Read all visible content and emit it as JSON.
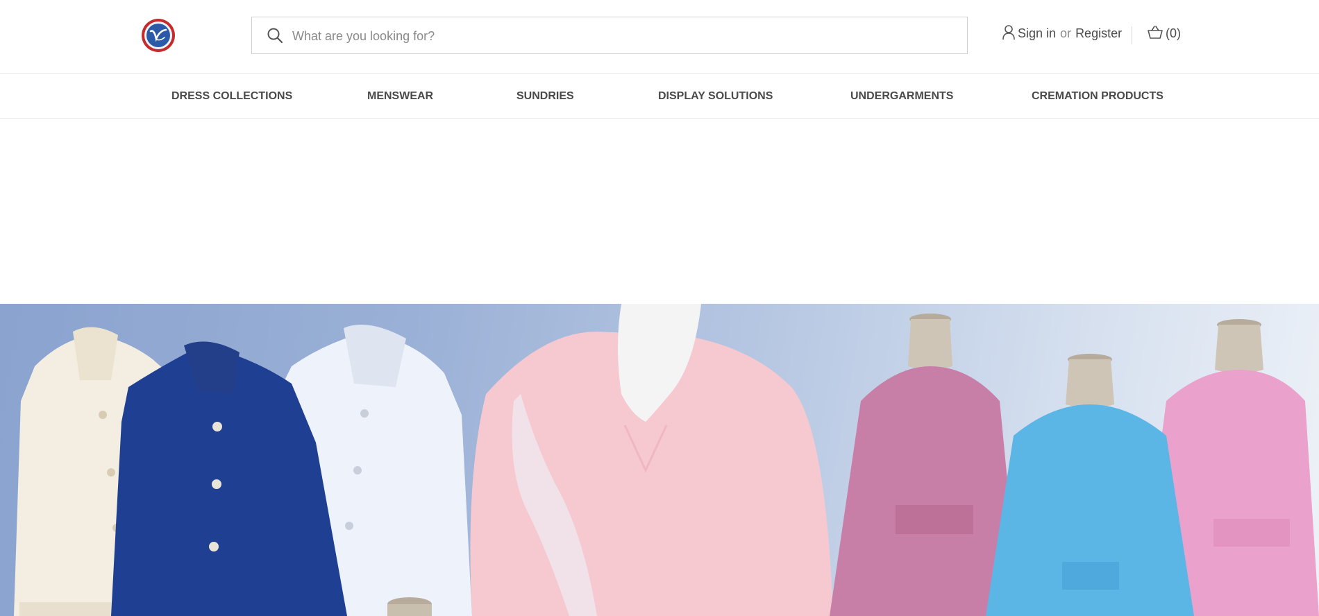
{
  "header": {
    "logo_alt": "Vega logo",
    "search": {
      "placeholder": "What are you looking for?",
      "value": ""
    },
    "account": {
      "sign_in": "Sign in",
      "or": "or",
      "register": "Register"
    },
    "cart": {
      "label": "(0)"
    }
  },
  "nav": {
    "items": [
      {
        "label": "DRESS COLLECTIONS"
      },
      {
        "label": "MENSWEAR"
      },
      {
        "label": "SUNDRIES"
      },
      {
        "label": "DISPLAY SOLUTIONS"
      },
      {
        "label": "UNDERGARMENTS"
      },
      {
        "label": "CREMATION PRODUCTS"
      }
    ]
  },
  "colors": {
    "text": "#4a4a4a",
    "muted": "#8a8a8a",
    "border": "#cfcfcf",
    "logo_red": "#c62b2b",
    "logo_blue": "#2a5aa8",
    "hero_blue": "#8aa3cf",
    "jacket_navy": "#1f3f92",
    "jacket_ivory": "#f3ede2",
    "jacket_white": "#eef2fb",
    "gown_pink": "#f6c8d0",
    "dress_mauve": "#c77fa8",
    "dress_blue": "#5bb6e6",
    "dress_pink": "#eaa2cc"
  },
  "icons": [
    "search-icon",
    "user-icon",
    "cart-icon"
  ]
}
